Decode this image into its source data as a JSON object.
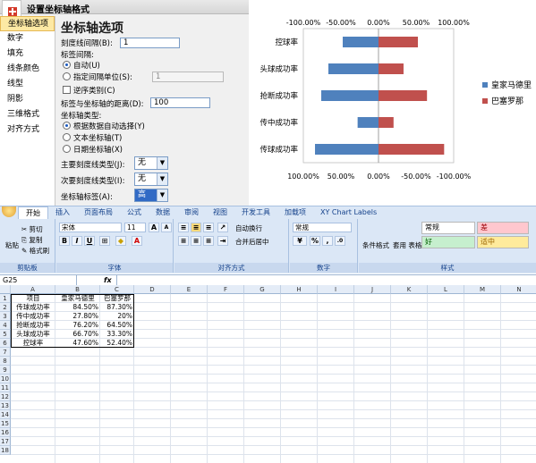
{
  "dialog": {
    "title": "设置坐标轴格式",
    "categories": [
      "坐标轴选项",
      "数字",
      "填充",
      "线条颜色",
      "线型",
      "阴影",
      "三维格式",
      "对齐方式"
    ],
    "selected_category": 0,
    "panel_title": "坐标轴选项",
    "tick_interval_label": "刻度线间隔(B):",
    "tick_interval_value": "1",
    "label_interval_label": "标签间隔:",
    "auto_label": "自动(U)",
    "specify_label": "指定间隔单位(S):",
    "specify_value": "1",
    "reverse_label": "逆序类别(C)",
    "label_distance_label": "标签与坐标轴的距离(D):",
    "label_distance_value": "100",
    "axis_type_label": "坐标轴类型:",
    "axis_type_auto": "根据数据自动选择(Y)",
    "axis_type_text": "文本坐标轴(T)",
    "axis_type_date": "日期坐标轴(X)",
    "major_tick_label": "主要刻度线类型(J):",
    "major_tick_value": "无",
    "minor_tick_label": "次要刻度线类型(I):",
    "minor_tick_value": "无",
    "axis_label_label": "坐标轴标签(A):",
    "axis_label_value": "高"
  },
  "chart_data": {
    "type": "bar",
    "orientation": "horizontal",
    "categories": [
      "控球率",
      "头球成功率",
      "抢断成功率",
      "传中成功率",
      "传球成功率"
    ],
    "series": [
      {
        "name": "皇家马德里",
        "values": [
          -47.6,
          -66.7,
          -76.2,
          -27.8,
          -84.5
        ],
        "color": "#4f81bd"
      },
      {
        "name": "巴塞罗那",
        "values": [
          52.4,
          33.3,
          64.5,
          20,
          87.3
        ],
        "color": "#c0504d"
      }
    ],
    "top_axis_ticks": [
      "-100.00%",
      "-50.00%",
      "0.00%",
      "50.00%",
      "100.00%"
    ],
    "bottom_axis_ticks": [
      "100.00%",
      "50.00%",
      "0.00%",
      "-50.00%",
      "-100.00%"
    ],
    "xlim": [
      -100,
      100
    ],
    "legend_position": "right",
    "grid": false
  },
  "ribbon": {
    "tabs": [
      "开始",
      "插入",
      "页面布局",
      "公式",
      "数据",
      "审阅",
      "视图",
      "开发工具",
      "加载项",
      "XY Chart Labels"
    ],
    "active_tab": 0,
    "paste": "粘贴",
    "cut": "剪切",
    "copy": "复制",
    "format_painter": "格式刷",
    "clipboard": "剪贴板",
    "font_name": "宋体",
    "font_size": "11",
    "font_group": "字体",
    "wrap_text": "自动换行",
    "merge_center": "合并后居中",
    "align_group": "对齐方式",
    "number_format": "常规",
    "number_group": "数字",
    "cond_format": "条件格式",
    "table_format": "套用\n表格格式",
    "styles_group": "样式",
    "style_normal": "常规",
    "style_bad": "差",
    "style_good": "好",
    "style_neutral": "适中",
    "bold": "B",
    "italic": "I",
    "underline": "U"
  },
  "formula_bar": {
    "name_box": "G25",
    "fx": "fx",
    "content": ""
  },
  "sheet": {
    "columns": [
      "A",
      "B",
      "C",
      "D",
      "E",
      "F",
      "G",
      "H",
      "I",
      "J",
      "K",
      "L",
      "M",
      "N"
    ],
    "rows": [
      "1",
      "2",
      "3",
      "4",
      "5",
      "6",
      "7",
      "8",
      "9",
      "10",
      "11",
      "12",
      "13",
      "14",
      "15",
      "16",
      "17",
      "18"
    ],
    "header": [
      "项目",
      "皇家马德里",
      "巴塞罗那"
    ],
    "data": [
      [
        "传球成功率",
        "84.50%",
        "87.30%"
      ],
      [
        "传中成功率",
        "27.80%",
        "20%"
      ],
      [
        "抢断成功率",
        "76.20%",
        "64.50%"
      ],
      [
        "头球成功率",
        "66.70%",
        "33.30%"
      ],
      [
        "控球率",
        "47.60%",
        "52.40%"
      ]
    ]
  }
}
